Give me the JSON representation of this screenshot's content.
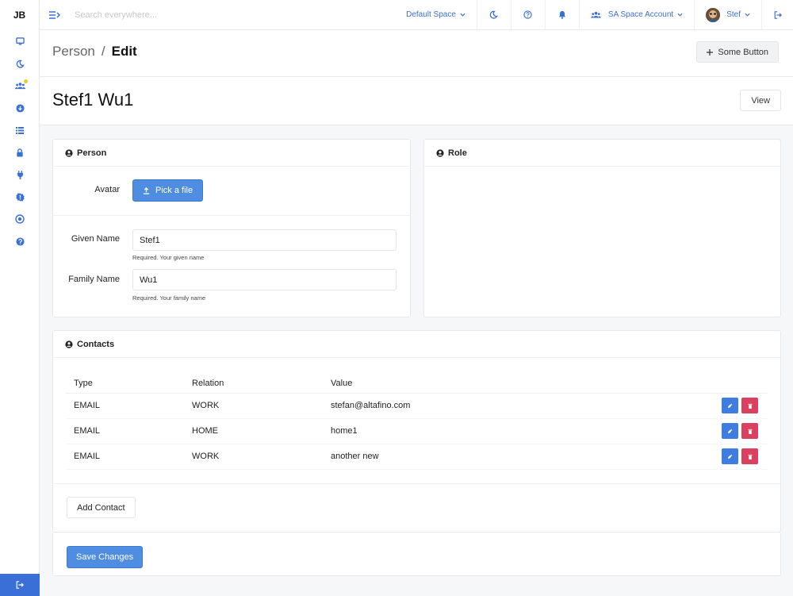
{
  "brand": "JB",
  "sidebar": {
    "items": [
      {
        "icon": "monitor-icon"
      },
      {
        "icon": "moon-icon"
      },
      {
        "icon": "users-icon",
        "badge_color": "#f3c928"
      },
      {
        "icon": "arrow-down-circle-icon"
      },
      {
        "icon": "list-icon"
      },
      {
        "icon": "lock-icon"
      },
      {
        "icon": "plug-icon"
      },
      {
        "icon": "gear-badge-icon"
      },
      {
        "icon": "eye-circle-icon"
      },
      {
        "icon": "help-circle-icon"
      }
    ],
    "logout_icon": "logout-icon"
  },
  "topbar": {
    "search_placeholder": "Search everywhere...",
    "space": "Default Space",
    "account": "SA Space Account",
    "user": "Stef"
  },
  "header": {
    "breadcrumb_parent": "Person",
    "breadcrumb_sep": "/",
    "breadcrumb_current": "Edit",
    "some_button": "Some Button"
  },
  "title": {
    "name": "Stef1 Wu1",
    "view_button": "View"
  },
  "person_card": {
    "title": "Person",
    "avatar_label": "Avatar",
    "pick_file": "Pick a file",
    "given_name_label": "Given Name",
    "given_name_value": "Stef1",
    "given_name_help": "Required. Your given name",
    "family_name_label": "Family Name",
    "family_name_value": "Wu1",
    "family_name_help": "Required. Your family name"
  },
  "role_card": {
    "title": "Role"
  },
  "contacts": {
    "title": "Contacts",
    "columns": [
      "Type",
      "Relation",
      "Value"
    ],
    "rows": [
      {
        "type": "EMAIL",
        "relation": "WORK",
        "value": "stefan@altafino.com"
      },
      {
        "type": "EMAIL",
        "relation": "HOME",
        "value": "home1"
      },
      {
        "type": "EMAIL",
        "relation": "WORK",
        "value": "another new"
      }
    ],
    "add_button": "Add Contact"
  },
  "save_button": "Save Changes",
  "colors": {
    "accent": "#3b6fd8",
    "primary_button": "#4f8de0",
    "danger": "#dc4060",
    "badge": "#f3c928"
  }
}
